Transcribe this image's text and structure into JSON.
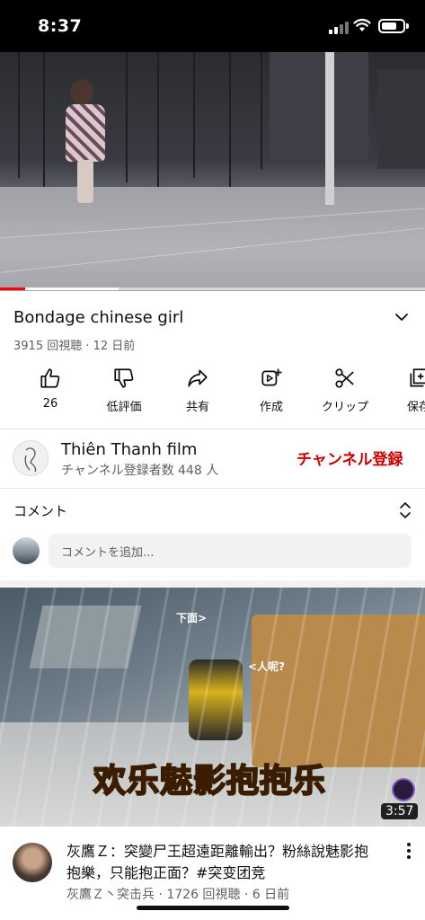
{
  "status_bar": {
    "time": "8:37"
  },
  "player": {
    "progress_fraction": 0.06,
    "buffer_fraction": 0.28,
    "progress_color": "#ff0000"
  },
  "video": {
    "title": "Bondage chinese girl",
    "meta": "3915 回視聴 · 12 日前"
  },
  "actions": [
    {
      "icon": "thumbs-up-icon",
      "label": "26"
    },
    {
      "icon": "thumbs-down-icon",
      "label": "低評価"
    },
    {
      "icon": "share-icon",
      "label": "共有"
    },
    {
      "icon": "remix-icon",
      "label": "作成"
    },
    {
      "icon": "scissors-icon",
      "label": "クリップ"
    },
    {
      "icon": "save-icon",
      "label": "保存"
    }
  ],
  "channel": {
    "name": "Thiên Thanh film",
    "subscribers": "チャンネル登録者数 448 人",
    "subscribe_label": "チャンネル登録",
    "subscribe_color": "#cc0000"
  },
  "comments": {
    "title": "コメント",
    "placeholder": "コメントを追加..."
  },
  "recommended": {
    "thumbnail_banner": "欢乐魅影抱抱乐",
    "thumbnail_tag_1": "下面>",
    "thumbnail_tag_2": "<人呢?",
    "duration": "3:57",
    "title": "灰鷹Ｚ：突變尸王超遠距離輸出？粉絲說魅影抱抱樂，只能抱正面？#突变团竞",
    "meta": "灰鷹Ｚ丶突击兵 · 1726 回視聴 · 6 日前"
  }
}
